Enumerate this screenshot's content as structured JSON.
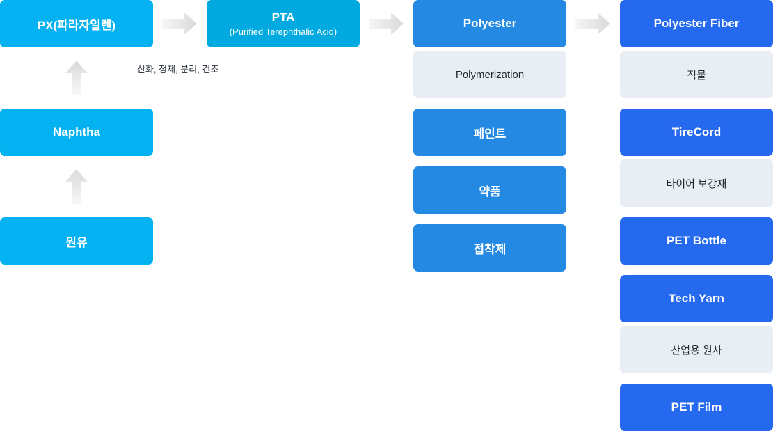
{
  "diagram": {
    "title": "",
    "colors": {
      "raw": "#04B1F1",
      "pta": "#00A9E0",
      "polyester": "#2489E2",
      "fiber": "#2569EE",
      "description_bg": "#E8EEF4",
      "arrow": "#DDDDDD"
    },
    "raw_column": {
      "px": "PX(파라자일렌)",
      "naphtha": "Naphtha",
      "crude": "원유"
    },
    "pta": {
      "title": "PTA",
      "subtitle": "(Purified Terephthalic Acid)",
      "process_note": "산화, 정제, 분리, 건조"
    },
    "polyester_column": {
      "title": "Polyester",
      "process": "Polymerization",
      "items": [
        "페인트",
        "약품",
        "접착제"
      ]
    },
    "fiber_column": {
      "items": [
        {
          "label": "Polyester Fiber",
          "description": "직물"
        },
        {
          "label": "TireCord",
          "description": "타이어 보강재"
        },
        {
          "label": "PET Bottle",
          "description": null
        },
        {
          "label": "Tech Yarn",
          "description": "산업용 원사"
        },
        {
          "label": "PET Film",
          "description": null
        }
      ]
    },
    "arrows": [
      {
        "from": "원유",
        "to": "Naphtha",
        "direction": "up"
      },
      {
        "from": "Naphtha",
        "to": "PX(파라자일렌)",
        "direction": "up"
      },
      {
        "from": "PX(파라자일렌)",
        "to": "PTA",
        "direction": "right"
      },
      {
        "from": "PTA",
        "to": "Polyester",
        "direction": "right"
      },
      {
        "from": "Polyester",
        "to": "Polyester Fiber",
        "direction": "right"
      }
    ]
  }
}
